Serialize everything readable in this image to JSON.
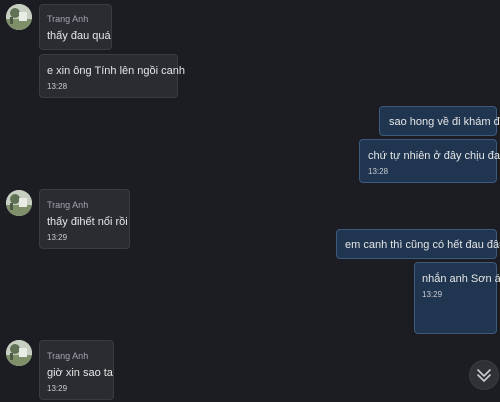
{
  "colors": {
    "background": "#1b1d22",
    "incoming_bubble": "#2a2c31",
    "outgoing_bubble": "#1f3550",
    "outgoing_border": "#3d5a7c"
  },
  "messages": [
    {
      "sender": "Trang Anh",
      "text": "thấy đau quá"
    },
    {
      "text": "e xin ông Tính lên ngồi canh",
      "time": "13:28"
    },
    {
      "text": "sao hong về đi khám đi"
    },
    {
      "text": "chứ tự nhiên ở đây chịu đau",
      "time": "13:28"
    },
    {
      "sender": "Trang Anh",
      "text": "thấy đihết nổi rồi",
      "time": "13:29"
    },
    {
      "text": "em canh thì cũng có hết đau đâu"
    },
    {
      "text": "nhắn anh Sơn á",
      "time": "13:29"
    },
    {
      "sender": "Trang Anh",
      "text": "giờ xin sao ta",
      "time": "13:29"
    }
  ],
  "icons": {
    "avatar": "avatar-photo",
    "scroll": "double-chevron-down-icon"
  }
}
